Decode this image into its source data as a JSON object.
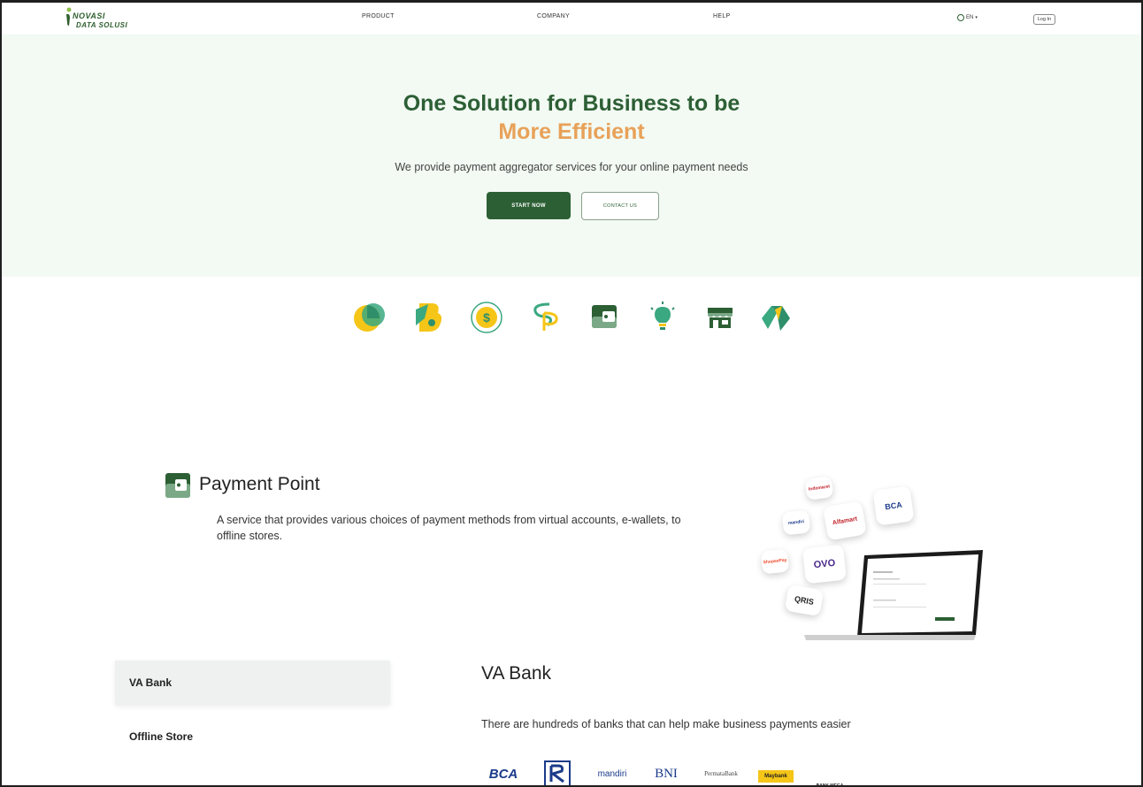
{
  "nav": {
    "logo_top": "NOVASI",
    "logo_bottom": "DATA SOLUSI",
    "links": [
      "PRODUCT",
      "COMPANY",
      "HELP"
    ],
    "lang": "EN",
    "login": "Log In"
  },
  "hero": {
    "title": "One Solution for Business to be",
    "highlight": "More Efficient",
    "desc": "We provide payment aggregator services for your online payment needs",
    "start_button": "START NOW",
    "contact_button": "CONTACT US"
  },
  "products": {
    "icons": [
      "pie-chart-icon",
      "b-letter-icon",
      "dollar-coin-icon",
      "sp-letter-icon",
      "wallet-icon",
      "lightbulb-icon",
      "store-icon",
      "diamond-logo-icon"
    ]
  },
  "payment_point": {
    "title": "Payment Point",
    "desc": "A service that provides various choices of payment methods from virtual accounts, e-wallets, to offline stores.",
    "badges": [
      "BCA",
      "Alfamart",
      "OVO",
      "QRIS",
      "ShopeePay",
      "mandiri",
      "Indomaret"
    ]
  },
  "tabs": [
    "VA Bank",
    "Offline Store"
  ],
  "va": {
    "title": "VA Bank",
    "desc": "There are hundreds of banks that can help make business payments easier",
    "banks": [
      "BCA",
      "BRI",
      "mandiri",
      "BNI",
      "PermataBank",
      "Maybank",
      "BANK MEGA"
    ]
  },
  "colors": {
    "primary": "#2c5f34",
    "accent": "#e8a159",
    "hero_bg": "#f2faf3"
  }
}
